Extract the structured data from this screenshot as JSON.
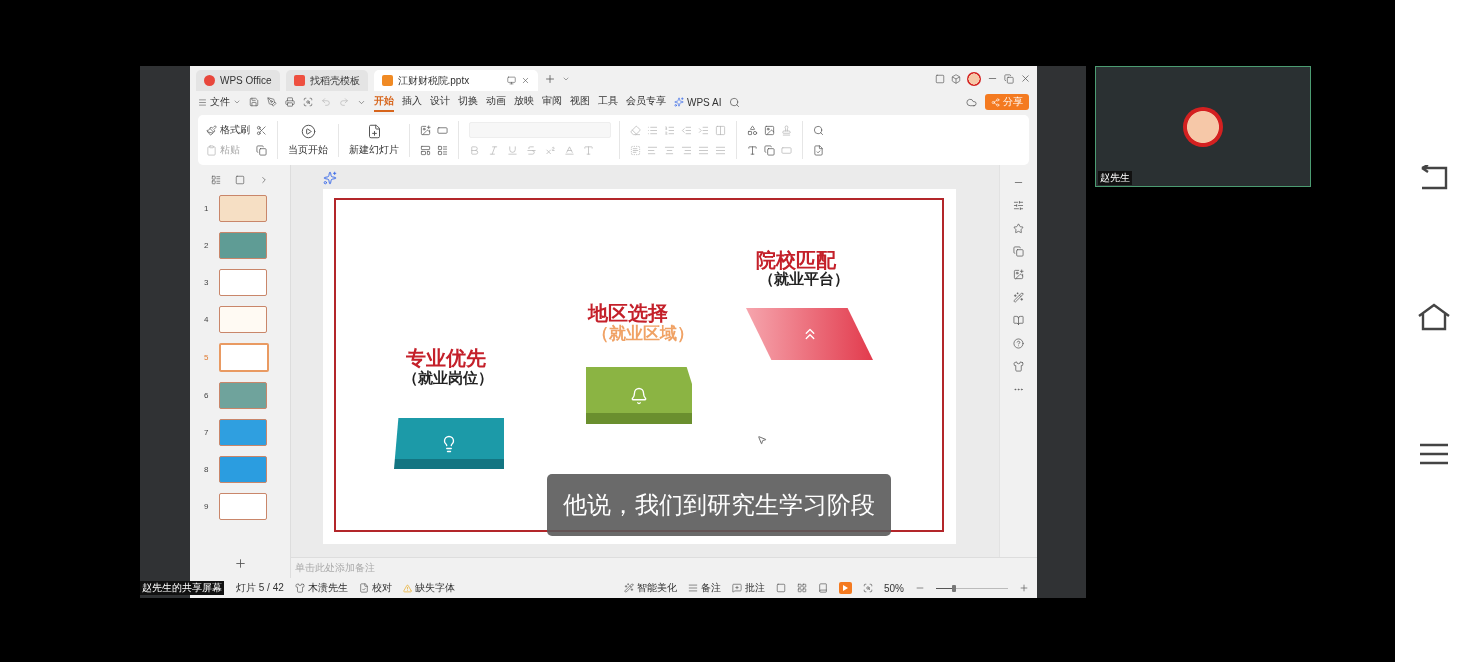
{
  "window_tabs": [
    {
      "label": "WPS Office",
      "selected": false,
      "kind": "home"
    },
    {
      "label": "找稻壳模板",
      "selected": false,
      "kind": "template"
    },
    {
      "label": "江财财税院.pptx",
      "selected": true,
      "kind": "document"
    }
  ],
  "menu": {
    "file": "文件",
    "ribbon_tabs": [
      {
        "label": "开始",
        "selected": true
      },
      {
        "label": "插入",
        "selected": false
      },
      {
        "label": "设计",
        "selected": false
      },
      {
        "label": "切换",
        "selected": false
      },
      {
        "label": "动画",
        "selected": false
      },
      {
        "label": "放映",
        "selected": false
      },
      {
        "label": "审阅",
        "selected": false
      },
      {
        "label": "视图",
        "selected": false
      },
      {
        "label": "工具",
        "selected": false
      },
      {
        "label": "会员专享",
        "selected": false
      }
    ],
    "ai": "WPS AI",
    "share": "分享"
  },
  "ribbon": {
    "format_painter": "格式刷",
    "paste": "粘贴",
    "play_from_current": "当页开始",
    "new_slide": "新建幻灯片"
  },
  "slides": [
    {
      "number": "1",
      "selected": false,
      "color": "#f6dfc4"
    },
    {
      "number": "2",
      "selected": false,
      "color": "#5f9c95"
    },
    {
      "number": "3",
      "selected": false,
      "color": "#ffffff"
    },
    {
      "number": "4",
      "selected": false,
      "color": "#fffaf3"
    },
    {
      "number": "5",
      "selected": true,
      "color": "#ffffff"
    },
    {
      "number": "6",
      "selected": false,
      "color": "#6fa39c"
    },
    {
      "number": "7",
      "selected": false,
      "color": "#2f9fe0"
    },
    {
      "number": "8",
      "selected": false,
      "color": "#2b9de0"
    },
    {
      "number": "9",
      "selected": false,
      "color": "#ffffff"
    }
  ],
  "slide": {
    "blocks": [
      {
        "kind": "platform",
        "title": "院校匹配",
        "subtitle": "（就业平台）"
      },
      {
        "kind": "region",
        "title": "地区选择",
        "subtitle": "（就业区域）"
      },
      {
        "kind": "major",
        "title": "专业优先",
        "subtitle": "（就业岗位）"
      }
    ]
  },
  "subtitle": "他说，我们到研究生学习阶段",
  "notes": {
    "placeholder": "单击此处添加备注"
  },
  "status_bar": {
    "slide_counter": "灯片 5 / 42",
    "author": "木溃先生",
    "proofread": "校对",
    "missing_fonts": "缺失字体",
    "beautify": "智能美化",
    "notes": "备注",
    "comments": "批注",
    "zoom": "50%",
    "zoom_slider": {
      "level": 0.25
    }
  },
  "share_label": "赵先生的共享屏幕",
  "participant": {
    "name": "赵先生"
  }
}
